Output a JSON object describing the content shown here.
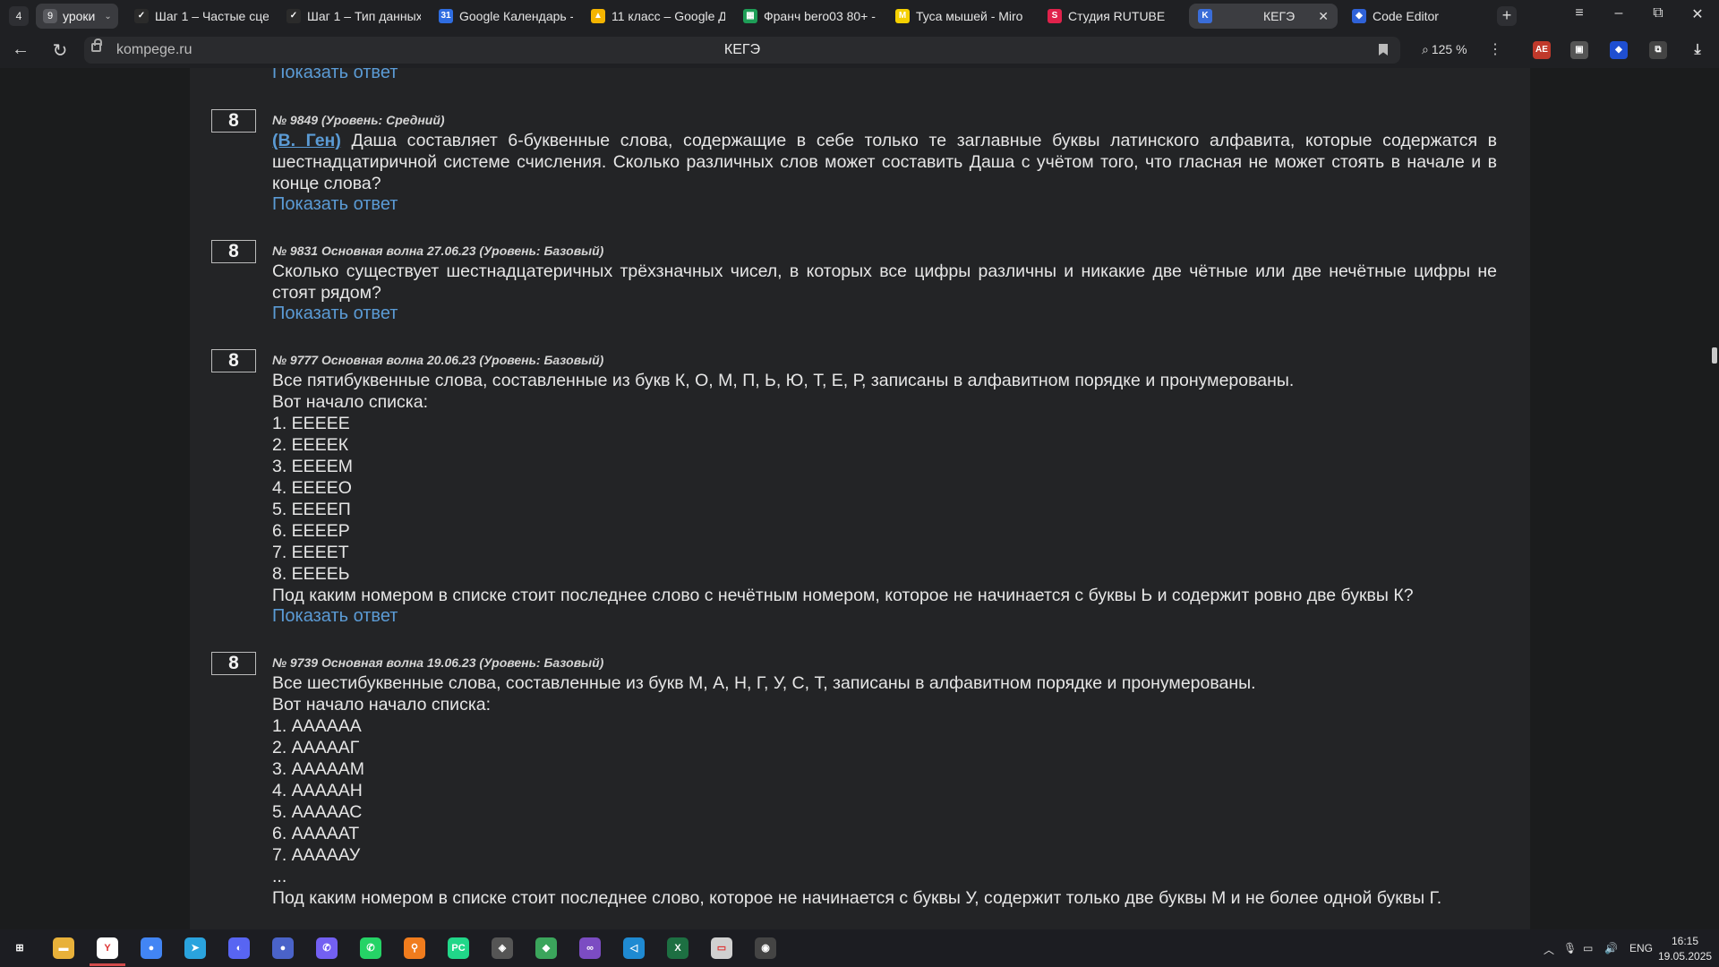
{
  "browser": {
    "tab_count": "4",
    "tab_group": {
      "icon": "9",
      "label": "уроки"
    },
    "tabs": [
      {
        "label": "Шаг 1 – Частые сце",
        "icon": "stepik-icon",
        "color": "#2b2b2b",
        "glyph": "✓"
      },
      {
        "label": "Шаг 1 – Тип данных",
        "icon": "stepik-icon",
        "color": "#2b2b2b",
        "glyph": "✓"
      },
      {
        "label": "Google Календарь -",
        "icon": "google-calendar-icon",
        "color": "#2f6de1",
        "glyph": "31"
      },
      {
        "label": "11 класс – Google Д",
        "icon": "google-drive-icon",
        "color": "#f4b400",
        "glyph": "▲"
      },
      {
        "label": "Франч bero03 80+ -",
        "icon": "google-sheets-icon",
        "color": "#1e9e57",
        "glyph": "▦"
      },
      {
        "label": "Туса мышей - Miro",
        "icon": "miro-icon",
        "color": "#f5d000",
        "glyph": "M"
      },
      {
        "label": "Студия RUTUBE",
        "icon": "rutube-icon",
        "color": "#e0224b",
        "glyph": "S"
      },
      {
        "label": "КЕГЭ",
        "icon": "kege-icon",
        "color": "#3a6dd8",
        "glyph": "K",
        "active": true
      },
      {
        "label": "Code Editor",
        "icon": "code-editor-icon",
        "color": "#2f62d8",
        "glyph": "◆"
      }
    ],
    "url_domain": "kompege.ru",
    "page_title": "КЕГЭ",
    "zoom": "125 %"
  },
  "page": {
    "top_show_answer": "Показать ответ",
    "show_answer_label": "Показать ответ",
    "tasks": [
      {
        "number": "8",
        "meta": "№ 9849 (Уровень: Средний)",
        "author": "(В. Ген)",
        "text": "Даша составляет 6-буквенные слова, содержащие в себе только те заглавные буквы латинского алфавита, которые содержатся в шестнадцатиричной системе счисления. Сколько различных слов может составить Даша с учётом того, что гласная не может стоять в начале и в конце слова?"
      },
      {
        "number": "8",
        "meta": "№ 9831 Основная волна 27.06.23 (Уровень: Базовый)",
        "text": "Сколько существует шестнадцатеричных трёхзначных чисел, в которых все цифры различны и никакие две чётные или две нечётные цифры не стоят рядом?"
      },
      {
        "number": "8",
        "meta": "№ 9777 Основная волна 20.06.23 (Уровень: Базовый)",
        "lines": [
          "Все пятибуквенные слова, составленные из букв К, О, М, П, Ь, Ю, Т, Е, Р, записаны в алфавитном порядке и пронумерованы.",
          "Вот начало списка:",
          "1. ЕЕЕЕЕ",
          "2. ЕЕЕЕК",
          "3. ЕЕЕЕМ",
          "4. ЕЕЕЕО",
          "5. ЕЕЕЕП",
          "6. ЕЕЕЕР",
          "7. ЕЕЕЕТ",
          "8. ЕЕЕЕЬ",
          "Под каким номером в списке стоит последнее слово с нечётным номером, которое не начинается с буквы Ь и содержит ровно две буквы К?"
        ]
      },
      {
        "number": "8",
        "meta": "№ 9739 Основная волна 19.06.23 (Уровень: Базовый)",
        "lines": [
          "Все шестибуквенные слова, составленные из букв М, А, Н, Г, У, С, Т, записаны в алфавитном порядке и пронумерованы.",
          "Вот начало начало списка:",
          "1. АААААА",
          "2. АААААГ",
          "3. АААААМ",
          "4. АААААН",
          "5. АААААС",
          "6. АААААТ",
          "7. АААААУ",
          "...",
          "Под каким номером в списке стоит последнее слово, которое не начинается с буквы У, содержит только две буквы М и не более одной буквы Г."
        ]
      }
    ]
  },
  "taskbar": {
    "apps": [
      {
        "name": "start-icon",
        "color": "#1c1d22",
        "glyph": "⊞"
      },
      {
        "name": "file-explorer-icon",
        "color": "#e8b13a",
        "glyph": "▬"
      },
      {
        "name": "yandex-browser-icon",
        "color": "#ffffff",
        "glyph": "Y",
        "active": true
      },
      {
        "name": "chrome-icon",
        "color": "#4285f4",
        "glyph": "●"
      },
      {
        "name": "telegram-icon",
        "color": "#2aa3de",
        "glyph": "➤"
      },
      {
        "name": "discord-icon",
        "color": "#5865f2",
        "glyph": "◐"
      },
      {
        "name": "generic-app-icon",
        "color": "#4a63c9",
        "glyph": "●"
      },
      {
        "name": "viber-icon",
        "color": "#7360f2",
        "glyph": "✆"
      },
      {
        "name": "whatsapp-icon",
        "color": "#25d366",
        "glyph": "✆"
      },
      {
        "name": "search-app-icon",
        "color": "#f07c1d",
        "glyph": "⚲"
      },
      {
        "name": "pycharm-icon",
        "color": "#21d789",
        "glyph": "PC"
      },
      {
        "name": "unity-icon",
        "color": "#555555",
        "glyph": "◈"
      },
      {
        "name": "vpn-icon",
        "color": "#3ba55c",
        "glyph": "◆"
      },
      {
        "name": "visual-studio-icon",
        "color": "#7b4cc2",
        "glyph": "∞"
      },
      {
        "name": "vscode-icon",
        "color": "#1f8ad2",
        "glyph": "◁"
      },
      {
        "name": "excel-icon",
        "color": "#1d6f42",
        "glyph": "X"
      },
      {
        "name": "terminal-icon",
        "color": "#d0d0d0",
        "glyph": "▭"
      },
      {
        "name": "obs-icon",
        "color": "#444444",
        "glyph": "◉"
      }
    ],
    "lang": "ENG",
    "time": "16:15",
    "date": "19.05.2025"
  }
}
